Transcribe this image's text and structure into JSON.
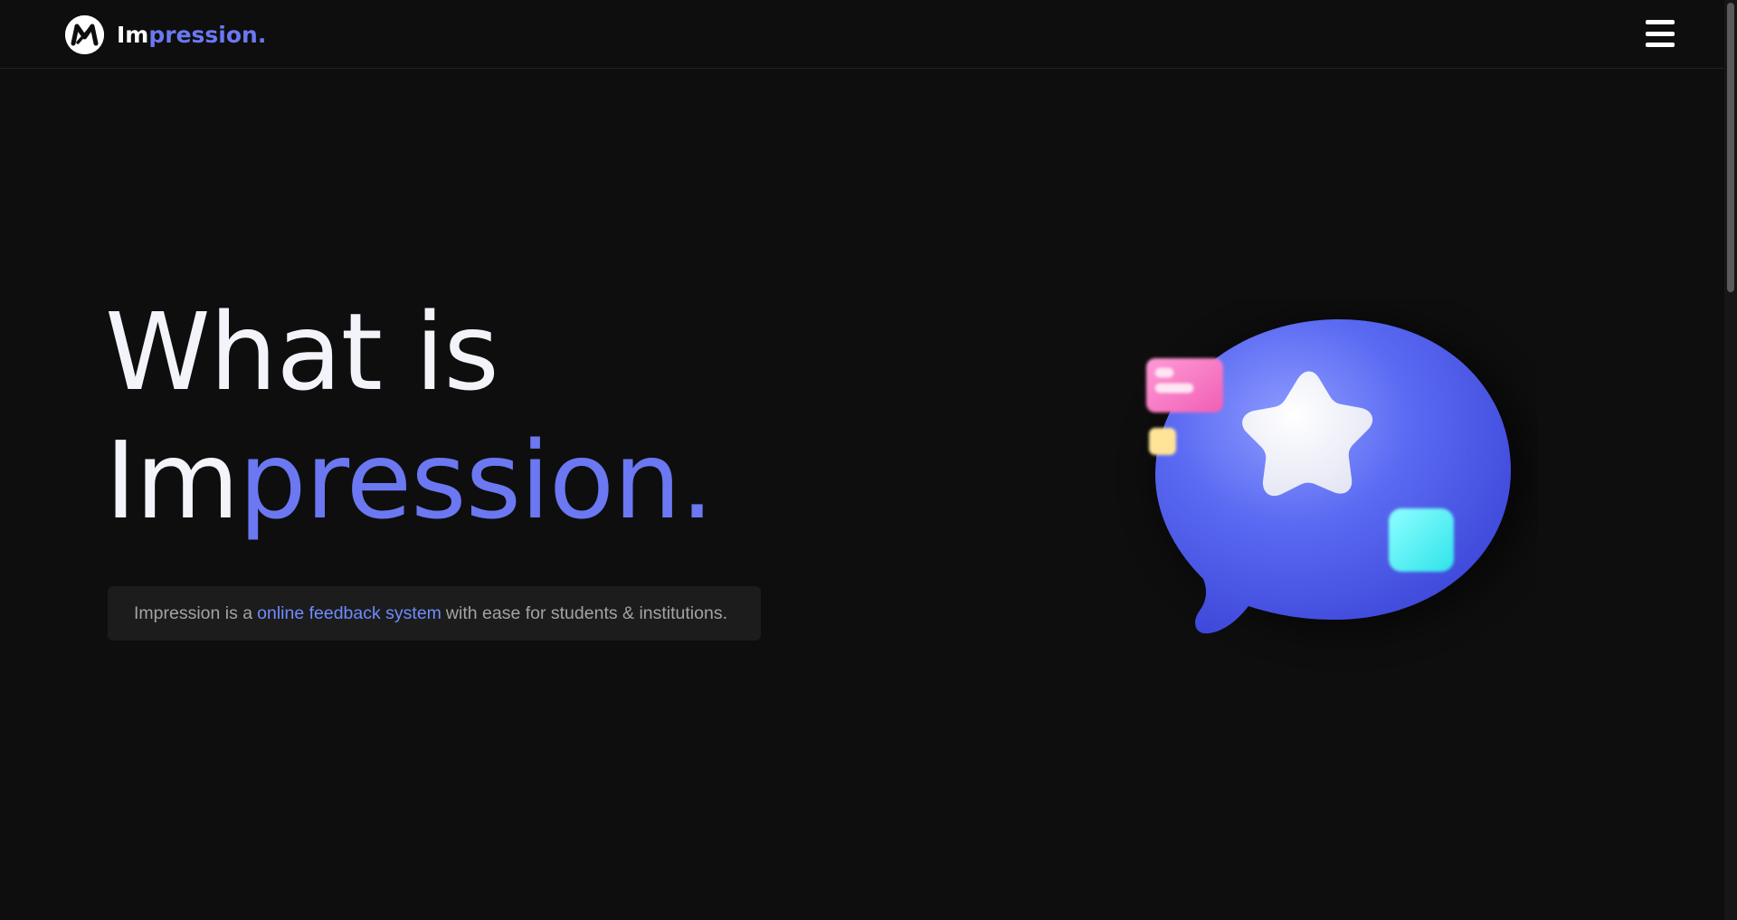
{
  "header": {
    "brand_prefix": "Im",
    "brand_suffix": "pression.",
    "menu_icon": "hamburger-menu-icon",
    "logo_icon": "impression-logo-icon"
  },
  "hero": {
    "title_line1": "What is",
    "title_line2_prefix": "Im",
    "title_line2_suffix": "pression.",
    "tagline_prefix": "Impression is a",
    "tagline_link": "online feedback system",
    "tagline_suffix": "with ease for students & institutions.",
    "illustration_icon": "chat-bubble-star-icon"
  },
  "colors": {
    "background": "#0e0e0e",
    "accent": "#6b78f2",
    "link": "#6f8bff",
    "tagline_bg": "#1c1c1c",
    "text_primary": "#f2f4fa",
    "text_muted": "#a3a3a3"
  }
}
